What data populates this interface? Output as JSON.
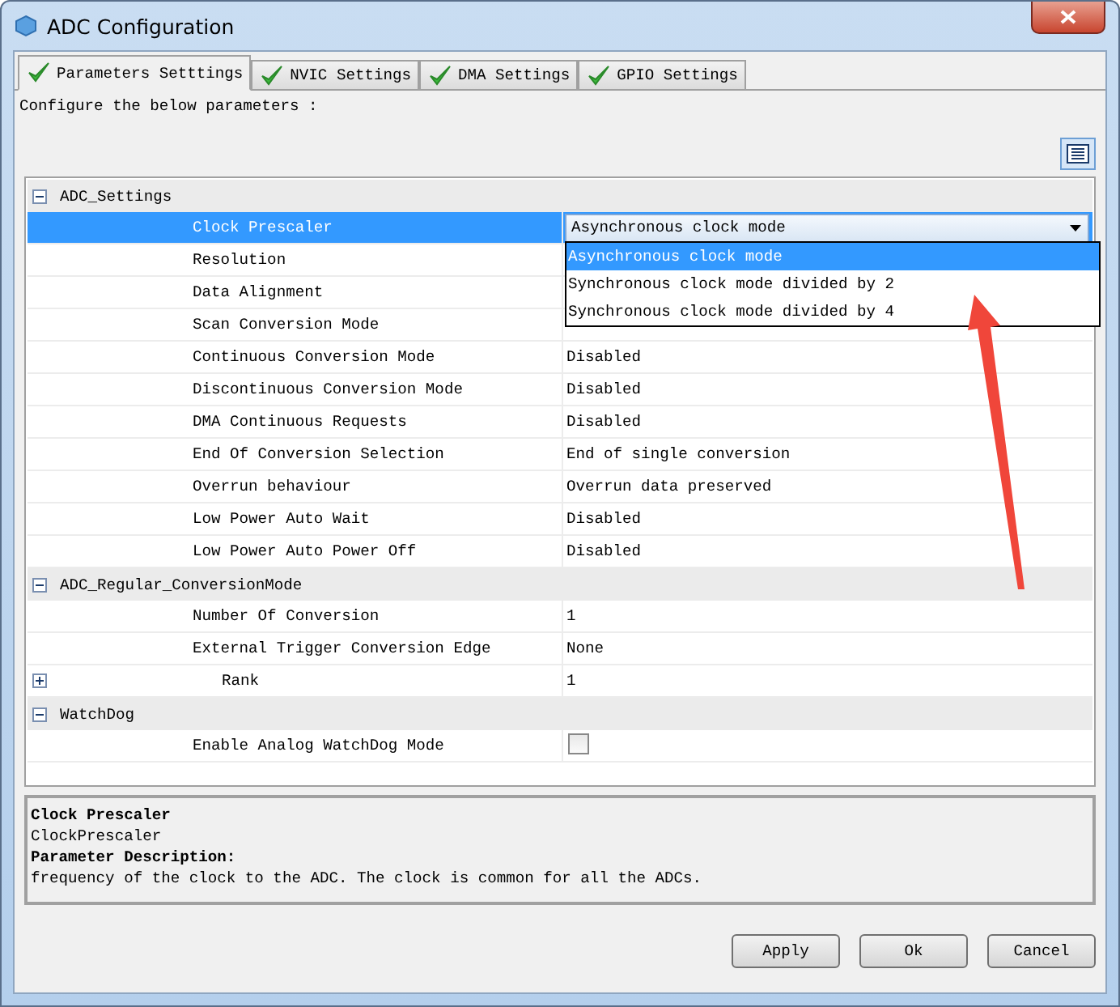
{
  "window": {
    "title": "ADC Configuration"
  },
  "tabs": [
    {
      "label": "Parameters Setttings",
      "selected": true
    },
    {
      "label": "NVIC Settings",
      "selected": false
    },
    {
      "label": "DMA Settings",
      "selected": false
    },
    {
      "label": "GPIO Settings",
      "selected": false
    }
  ],
  "intro": "Configure the below parameters :",
  "groups": [
    {
      "name": "ADC_Settings",
      "expanded": true,
      "children": [
        {
          "kind": "dropdown",
          "name": "Clock Prescaler",
          "value": "Asynchronous clock mode",
          "selected": true,
          "open": true,
          "options": [
            {
              "label": "Asynchronous clock mode",
              "selected": true
            },
            {
              "label": "Synchronous clock mode divided by 2",
              "selected": false
            },
            {
              "label": "Synchronous clock mode divided by 4",
              "selected": false
            }
          ]
        },
        {
          "kind": "text",
          "name": "Resolution",
          "selected": false
        },
        {
          "kind": "text",
          "name": "Data Alignment",
          "selected": false
        },
        {
          "kind": "text",
          "name": "Scan Conversion Mode",
          "selected": false
        },
        {
          "kind": "text",
          "name": "Continuous Conversion Mode",
          "value": "Disabled",
          "selected": false
        },
        {
          "kind": "text",
          "name": "Discontinuous Conversion Mode",
          "value": "Disabled",
          "selected": false
        },
        {
          "kind": "text",
          "name": "DMA Continuous Requests",
          "value": "Disabled",
          "selected": false
        },
        {
          "kind": "text",
          "name": "End Of Conversion Selection",
          "value": "End of single conversion",
          "selected": false
        },
        {
          "kind": "text",
          "name": "Overrun behaviour",
          "value": "Overrun data preserved",
          "selected": false
        },
        {
          "kind": "text",
          "name": "Low Power Auto Wait",
          "value": "Disabled",
          "selected": false
        },
        {
          "kind": "text",
          "name": "Low Power Auto Power Off",
          "value": "Disabled",
          "selected": false
        }
      ]
    },
    {
      "name": "ADC_Regular_ConversionMode",
      "expanded": true,
      "children": [
        {
          "kind": "text",
          "name": "Number Of Conversion",
          "value": "1",
          "selected": false
        },
        {
          "kind": "text",
          "name": "External Trigger Conversion Edge",
          "value": "None",
          "selected": false
        },
        {
          "kind": "subgroup",
          "name": "Rank",
          "value": "1",
          "selected": false,
          "expanded": false
        }
      ]
    },
    {
      "name": "WatchDog",
      "expanded": true,
      "children": [
        {
          "kind": "checkbox",
          "name": "Enable Analog WatchDog Mode",
          "checked": false,
          "selected": false
        }
      ]
    }
  ],
  "description": {
    "title": "Clock Prescaler",
    "id": "ClockPrescaler",
    "heading": "Parameter Description:",
    "text": "frequency of the clock to the ADC. The clock is common for all the ADCs."
  },
  "buttons": [
    "Apply",
    "Ok",
    "Cancel"
  ]
}
